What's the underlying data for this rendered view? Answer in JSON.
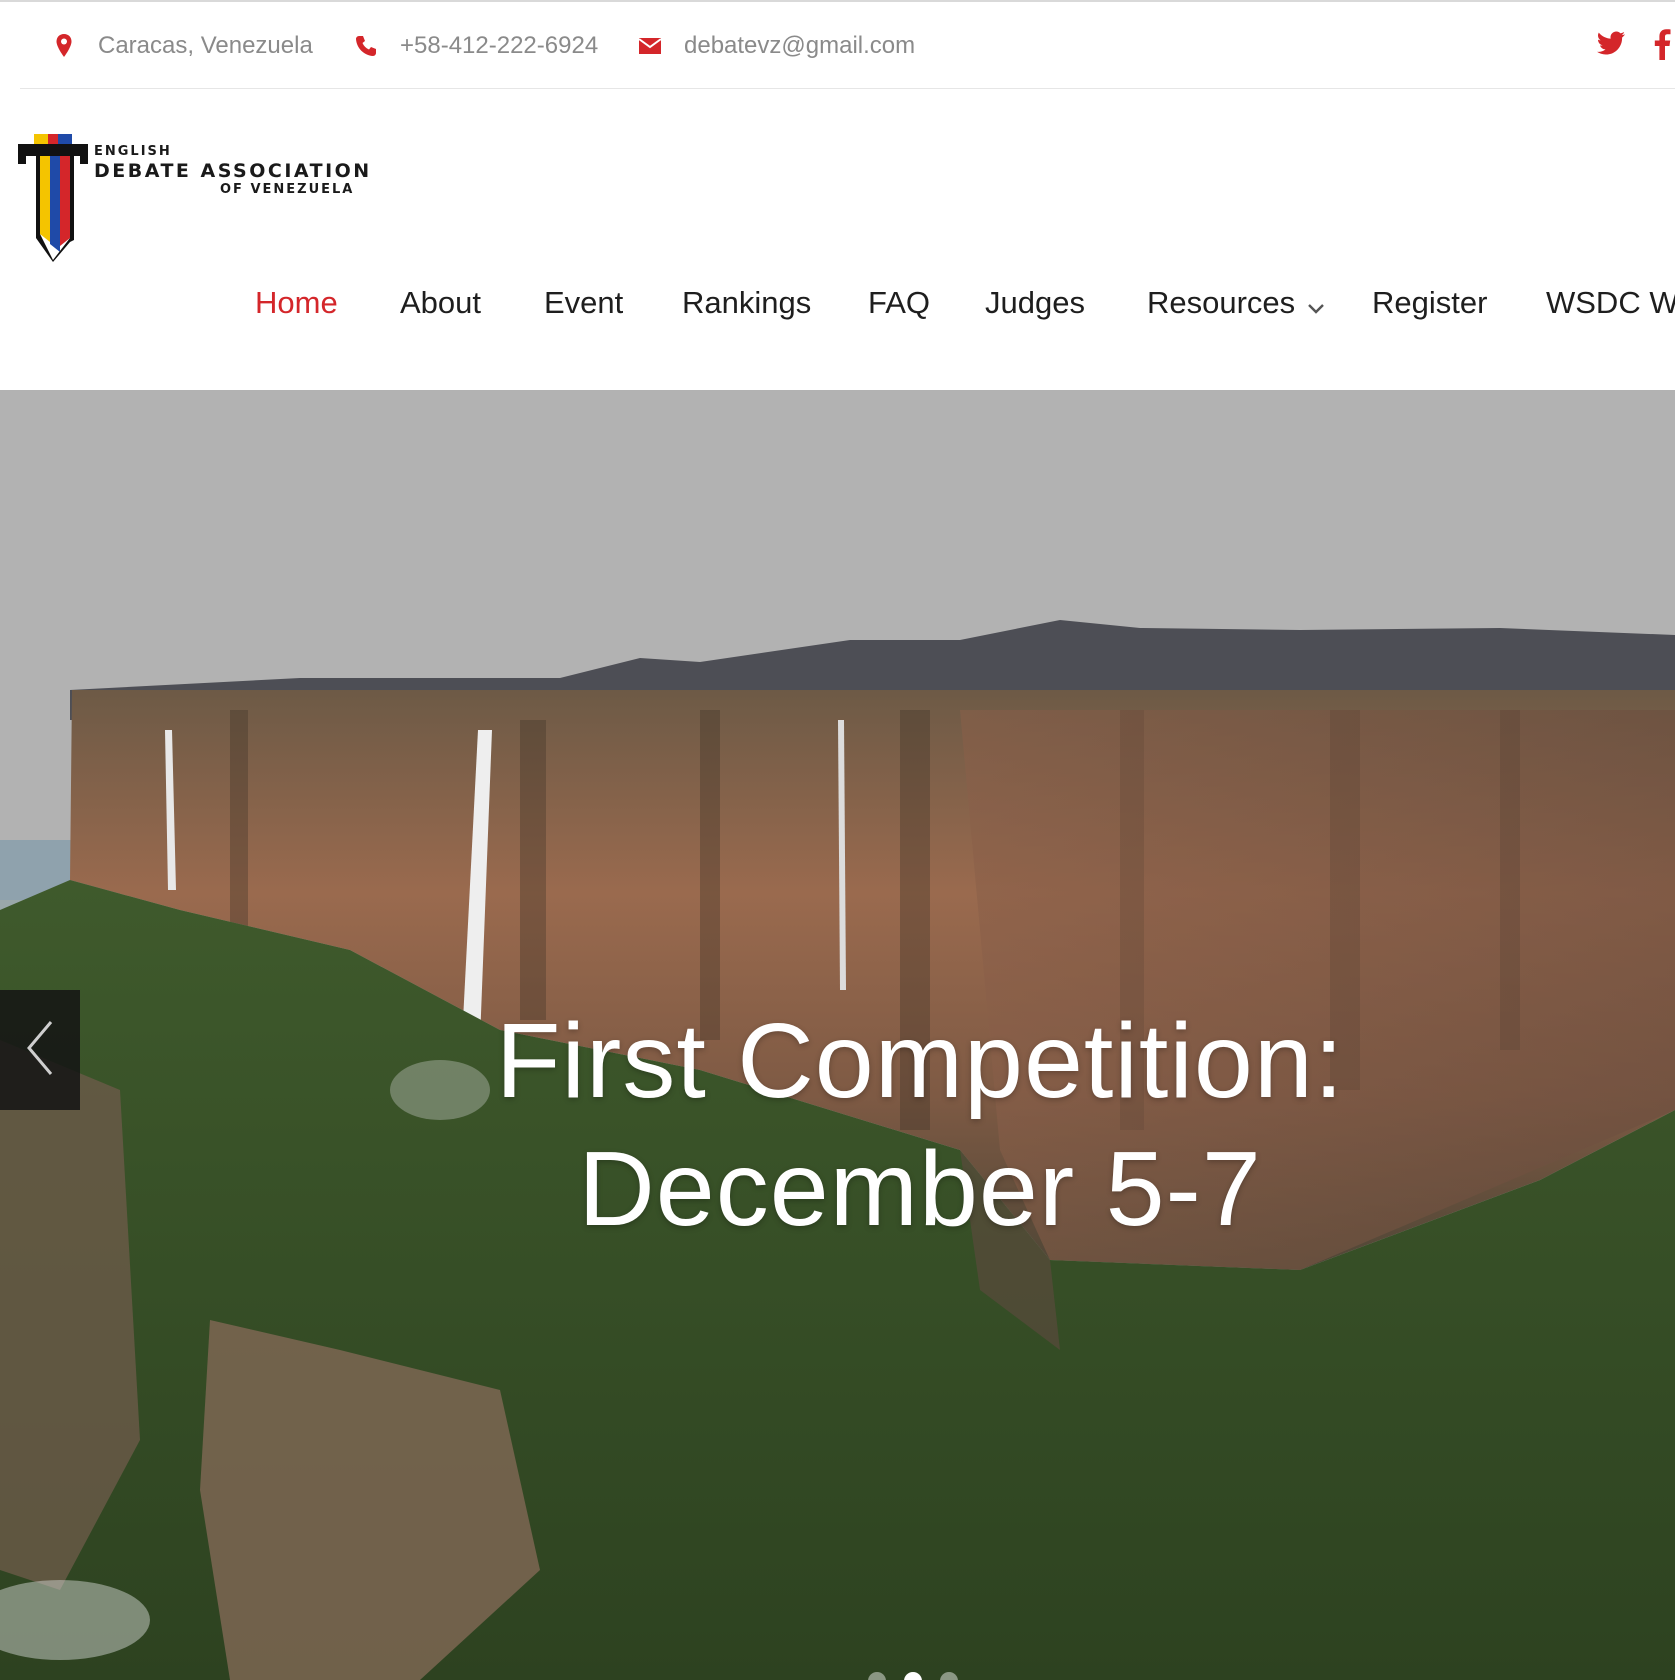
{
  "topbar": {
    "location": "Caracas, Venezuela",
    "phone": "+58-412-222-6924",
    "email": "debatevz@gmail.com",
    "icons": {
      "location": "map-pin-icon",
      "phone": "phone-icon",
      "email": "envelope-icon",
      "twitter": "twitter-icon",
      "facebook": "facebook-icon"
    },
    "accent_color": "#d4262a"
  },
  "logo": {
    "line1": "ENGLISH",
    "line2": "DEBATE ASSOCIATION",
    "line3": "OF VENEZUELA",
    "flag_colors": [
      "#f4c400",
      "#1f4aa8",
      "#d4262a"
    ]
  },
  "nav": {
    "items": [
      {
        "label": "Home",
        "active": true
      },
      {
        "label": "About"
      },
      {
        "label": "Event"
      },
      {
        "label": "Rankings"
      },
      {
        "label": "FAQ"
      },
      {
        "label": "Judges"
      },
      {
        "label": "Resources",
        "has_dropdown": true
      },
      {
        "label": "Register"
      },
      {
        "label": "WSDC W"
      }
    ],
    "active_color": "#d4262a"
  },
  "hero": {
    "title_line1": "First Competition:",
    "title_line2": "December 5-7",
    "prev_icon": "chevron-left-icon",
    "slides": 3,
    "active_slide": 2
  }
}
